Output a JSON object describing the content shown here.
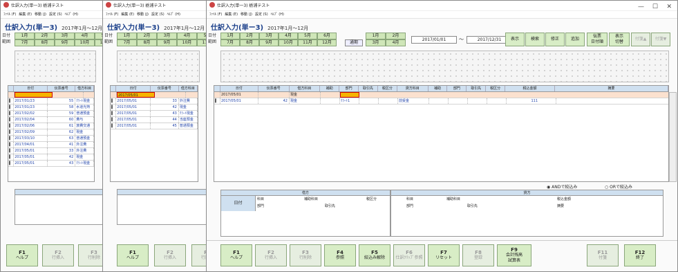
{
  "app_title": "仕訳入力(単一3) 栃浦テスト",
  "menu": [
    "ﾌｧｲﾙ (F)",
    "編集 (E)",
    "移動 (J)",
    "設定 (S)",
    "ﾍﾙﾌﾟ (H)"
  ],
  "page_title": "仕訳入力(単ー3)",
  "year_range": "2017年1月～12月",
  "range_label": "日付\n範囲",
  "months_top": [
    "1月",
    "2月",
    "3月",
    "4月",
    "5月",
    "6月"
  ],
  "months_bottom": [
    "7月",
    "8月",
    "9月",
    "10月",
    "11月",
    "12月"
  ],
  "tsuki": "通期",
  "q_top": [
    "1月",
    "2月"
  ],
  "q_bottom": [
    "3月",
    "4月"
  ],
  "date_from": "2017/01/01",
  "tilde": "～",
  "date_to": "2017/12/31",
  "toolbar": [
    "表示",
    "検索",
    "修正",
    "追加",
    "伝票\n日付順",
    "表示\n切替",
    "付箋▲",
    "付箋▼"
  ],
  "headers": [
    "日付",
    "伝票番号",
    "借方科目",
    "補助",
    "部門",
    "取引先",
    "税区分",
    "貸方科目",
    "補助",
    "部門",
    "取引先",
    "税区分",
    "税込金額",
    "摘要"
  ],
  "rows_w1": [
    [
      "2017/01/23",
      "55",
      "ｸﾗｰﾄ現金"
    ],
    [
      "2017/01/23",
      "58",
      "水道光熱"
    ],
    [
      "2017/02/02",
      "59",
      "普通預金"
    ],
    [
      "2017/02/04",
      "60",
      "費与"
    ],
    [
      "2017/02/06",
      "61",
      "旅費交通"
    ],
    [
      "2017/02/09",
      "62",
      "現金"
    ],
    [
      "2017/03/10",
      "63",
      "普通預金"
    ],
    [
      "2017/04/01",
      "41",
      "外注費"
    ],
    [
      "2017/05/01",
      "33",
      "外注費"
    ],
    [
      "2017/05/01",
      "42",
      "現金"
    ],
    [
      "2017/05/01",
      "43",
      "ｸﾗｰﾄ現金"
    ]
  ],
  "rows_w2": [
    [
      "2017/05/01",
      "33",
      "外注費"
    ],
    [
      "2017/05/01",
      "42",
      "現金"
    ],
    [
      "2017/05/01",
      "43",
      "ｸﾗｰﾄ現金"
    ],
    [
      "2017/05/01",
      "44",
      "当座預金"
    ],
    [
      "2017/05/01",
      "45",
      "普通預金"
    ]
  ],
  "sel_w1": "",
  "sel_w2": "2017/05/01",
  "sel_w3": "2017/05/01",
  "sel_w3_kamoku": "現金",
  "row_w3": {
    "date": "2017/05/01",
    "num": "42",
    "dk": "現金",
    "bumon": "ｸﾗｰﾄ1",
    "ck": "前受金",
    "amount": "111"
  },
  "radio_and": "ANDで絞込み",
  "radio_or": "ORで絞込み",
  "bottom_headers": {
    "debit": "借方",
    "credit": "貸方",
    "date": "日付",
    "kamoku": "科目",
    "hojo": "補助科目",
    "zei": "税区分",
    "bumon": "部門",
    "tori": "取引先",
    "amt": "税込金額",
    "tekiyo": "摘要"
  },
  "fkeys": [
    [
      "F1",
      "ヘルプ"
    ],
    [
      "F2",
      "行挿入"
    ],
    [
      "F3",
      "行削除"
    ],
    [
      "F4",
      "参照"
    ],
    [
      "F5",
      "絞込み解除"
    ],
    [
      "F6",
      "仕訳ｸﾘｯﾌﾟ参照"
    ],
    [
      "F7",
      "リセット"
    ],
    [
      "F8",
      "登録"
    ],
    [
      "F9",
      "会計残高\n試算表"
    ],
    [
      "F11",
      "付箋"
    ],
    [
      "F12",
      "終了"
    ]
  ]
}
